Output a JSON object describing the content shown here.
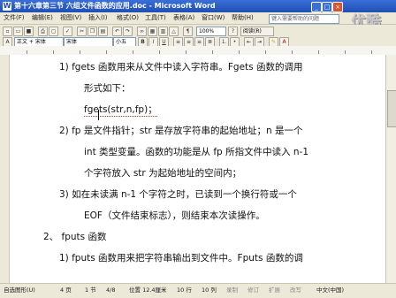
{
  "window": {
    "app_icon": "W",
    "title": "第十六章第三节 六组文件函数的应用.doc - Microsoft Word",
    "buttons": [
      "_",
      "□",
      "×"
    ]
  },
  "menu": {
    "items": [
      "文件(F)",
      "编辑(E)",
      "视图(V)",
      "插入(I)",
      "格式(O)",
      "工具(T)",
      "表格(A)",
      "窗口(W)",
      "帮助(H)"
    ],
    "help_placeholder": "键入需要帮助的问题"
  },
  "toolbar": {
    "zoom": "100%",
    "read_mode": "阅读(R)",
    "style": "正文 + 宋体",
    "font": "宋体",
    "size": "小五"
  },
  "watermark": "优酷",
  "document": {
    "lines": [
      {
        "text": "1)   fgets 函数用来从文件中读入字符串。Fgets 函数的调用"
      },
      {
        "text": "形式如下："
      },
      {
        "text": "fgets(str,n,fp)；"
      },
      {
        "text": "2)   fp 是文件指针；str 是存放字符串的起始地址；n 是一个"
      },
      {
        "text": "int 类型变量。函数的功能是从 fp 所指文件中读入 n-1"
      },
      {
        "text": "个字符放入 str 为起始地址的空间内；"
      },
      {
        "text": "3)   如在未读满 n-1 个字符之时，已读到一个换行符或一个"
      },
      {
        "text": "EOF（文件结束标志），则结束本次读操作。"
      },
      {
        "text": "2、   fputs 函数"
      },
      {
        "text": "1)   fputs 函数用来把字符串输出到文件中。Fputs 函数的调"
      }
    ]
  },
  "status": {
    "page": "4 页",
    "section": "1 节",
    "page_of": "4/8",
    "position": "位置 12.4厘米",
    "line": "10 行",
    "column": "10 列",
    "flags": [
      "录制",
      "修订",
      "扩展",
      "改写"
    ],
    "language": "中文(中国)",
    "draw_label": "自选图形(U)"
  }
}
